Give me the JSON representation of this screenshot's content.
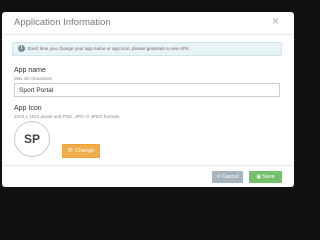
{
  "dialog": {
    "title": "Application Information",
    "close_icon": "×",
    "alert": {
      "icon": "info-icon",
      "text": "Each time you change your app name or app icon, please generate a new APK."
    }
  },
  "app_name": {
    "label": "App name",
    "hint": "Max 30 characters",
    "value": "Sport Portal"
  },
  "app_icon": {
    "label": "App Icon",
    "hint": "1024 x 1024 pixels and PNG, JPG or JPEG formats.",
    "avatar_text": "SP",
    "change_label": "Change",
    "change_icon": "refresh-icon"
  },
  "footer": {
    "cancel_label": "Cancel",
    "save_label": "Save"
  },
  "colors": {
    "change": "#f0ad4e",
    "cancel": "#a7b4bd",
    "save": "#71c16b",
    "alert_bg": "#e8f3f6"
  }
}
